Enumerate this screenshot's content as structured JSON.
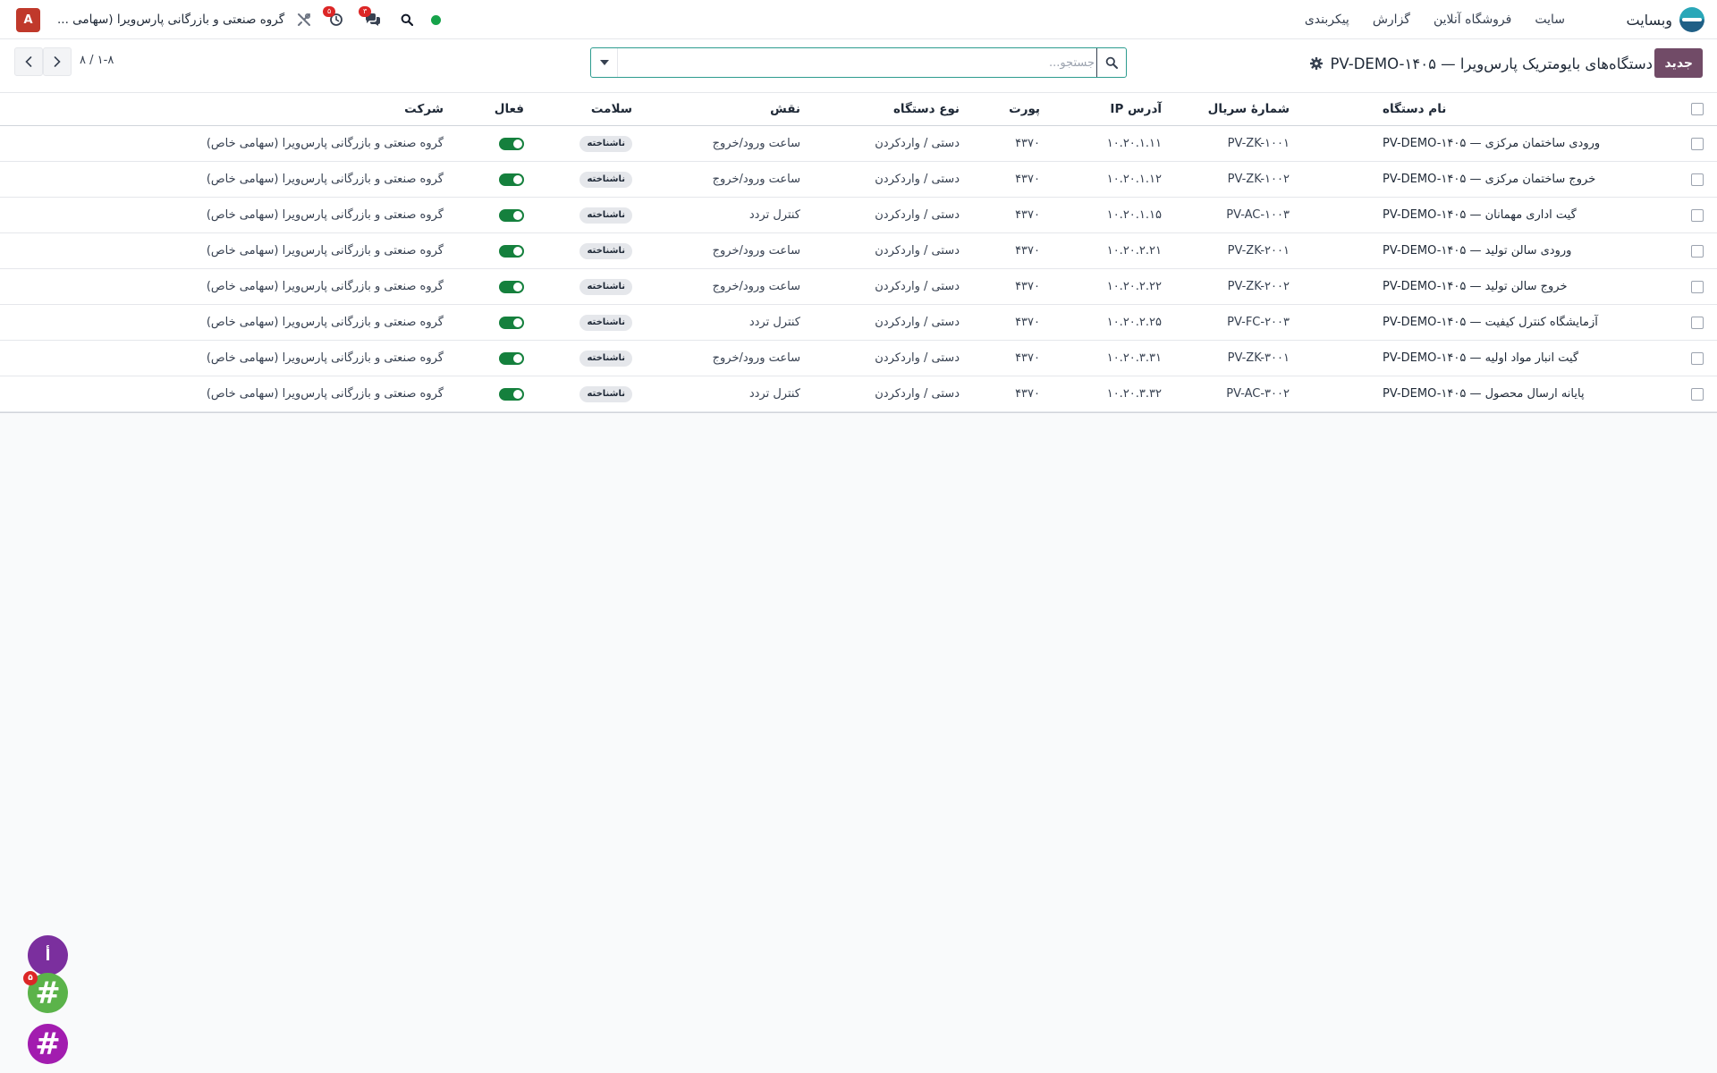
{
  "navbar": {
    "brand": "وبسایت",
    "menu": [
      "سایت",
      "فروشگاه آنلاین",
      "گزارش",
      "پیکربندی"
    ],
    "company": "گروه صنعتی و بازرگانی پارس‌ویرا (سهامی ...",
    "user_initial": "A",
    "activity_count": "۵",
    "messages_count": "۳",
    "icons": [
      "tools-icon",
      "clock-icon",
      "chat-icon",
      "search-icon",
      "presence-dot"
    ]
  },
  "control_panel": {
    "new_label": "جدید",
    "title": "دستگاه‌های بایومتریک پارس‌ویرا — PV-DEMO-۱۴۰۵",
    "search_placeholder": "جستجو...",
    "pager": "۱-۸ / ۸"
  },
  "table": {
    "headers": {
      "name": "نام دستگاه",
      "serial": "شمارهٔ سریال",
      "ip": "آدرس IP",
      "port": "پورت",
      "type": "نوع دستگاه",
      "role": "نقش",
      "health": "سلامت",
      "active": "فعال",
      "company": "شرکت"
    },
    "rows": [
      {
        "name": "ورودی ساختمان مرکزی — PV-DEMO-۱۴۰۵",
        "serial": "PV-ZK-۱۰۰۱",
        "ip": "۱۰.۲۰.۱.۱۱",
        "port": "۴۳۷۰",
        "type": "دستی / واردکردن",
        "role": "ساعت ورود/خروج",
        "health": "ناشناخته",
        "active": true,
        "company": "گروه صنعتی و بازرگانی پارس‌ویرا (سهامی خاص)"
      },
      {
        "name": "خروج ساختمان مرکزی — PV-DEMO-۱۴۰۵",
        "serial": "PV-ZK-۱۰۰۲",
        "ip": "۱۰.۲۰.۱.۱۲",
        "port": "۴۳۷۰",
        "type": "دستی / واردکردن",
        "role": "ساعت ورود/خروج",
        "health": "ناشناخته",
        "active": true,
        "company": "گروه صنعتی و بازرگانی پارس‌ویرا (سهامی خاص)"
      },
      {
        "name": "گیت اداری مهمانان — PV-DEMO-۱۴۰۵",
        "serial": "PV-AC-۱۰۰۳",
        "ip": "۱۰.۲۰.۱.۱۵",
        "port": "۴۳۷۰",
        "type": "دستی / واردکردن",
        "role": "کنترل تردد",
        "health": "ناشناخته",
        "active": true,
        "company": "گروه صنعتی و بازرگانی پارس‌ویرا (سهامی خاص)"
      },
      {
        "name": "ورودی سالن تولید — PV-DEMO-۱۴۰۵",
        "serial": "PV-ZK-۲۰۰۱",
        "ip": "۱۰.۲۰.۲.۲۱",
        "port": "۴۳۷۰",
        "type": "دستی / واردکردن",
        "role": "ساعت ورود/خروج",
        "health": "ناشناخته",
        "active": true,
        "company": "گروه صنعتی و بازرگانی پارس‌ویرا (سهامی خاص)"
      },
      {
        "name": "خروج سالن تولید — PV-DEMO-۱۴۰۵",
        "serial": "PV-ZK-۲۰۰۲",
        "ip": "۱۰.۲۰.۲.۲۲",
        "port": "۴۳۷۰",
        "type": "دستی / واردکردن",
        "role": "ساعت ورود/خروج",
        "health": "ناشناخته",
        "active": true,
        "company": "گروه صنعتی و بازرگانی پارس‌ویرا (سهامی خاص)"
      },
      {
        "name": "آزمایشگاه کنترل کیفیت — PV-DEMO-۱۴۰۵",
        "serial": "PV-FC-۲۰۰۳",
        "ip": "۱۰.۲۰.۲.۲۵",
        "port": "۴۳۷۰",
        "type": "دستی / واردکردن",
        "role": "کنترل تردد",
        "health": "ناشناخته",
        "active": true,
        "company": "گروه صنعتی و بازرگانی پارس‌ویرا (سهامی خاص)"
      },
      {
        "name": "گیت انبار مواد اولیه — PV-DEMO-۱۴۰۵",
        "serial": "PV-ZK-۳۰۰۱",
        "ip": "۱۰.۲۰.۳.۳۱",
        "port": "۴۳۷۰",
        "type": "دستی / واردکردن",
        "role": "ساعت ورود/خروج",
        "health": "ناشناخته",
        "active": true,
        "company": "گروه صنعتی و بازرگانی پارس‌ویرا (سهامی خاص)"
      },
      {
        "name": "پایانه ارسال محصول — PV-DEMO-۱۴۰۵",
        "serial": "PV-AC-۳۰۰۲",
        "ip": "۱۰.۲۰.۳.۳۲",
        "port": "۴۳۷۰",
        "type": "دستی / واردکردن",
        "role": "کنترل تردد",
        "health": "ناشناخته",
        "active": true,
        "company": "گروه صنعتی و بازرگانی پارس‌ویرا (سهامی خاص)"
      }
    ]
  },
  "chat_bubbles": [
    {
      "label": "أ",
      "badge": ""
    },
    {
      "label": "#",
      "badge": "۵"
    },
    {
      "label": "#",
      "badge": ""
    }
  ],
  "colors": {
    "primary": "#714b67",
    "toggle_on": "#15803d",
    "badge": "#dc2626",
    "search_focus": "#2d9c8f"
  }
}
